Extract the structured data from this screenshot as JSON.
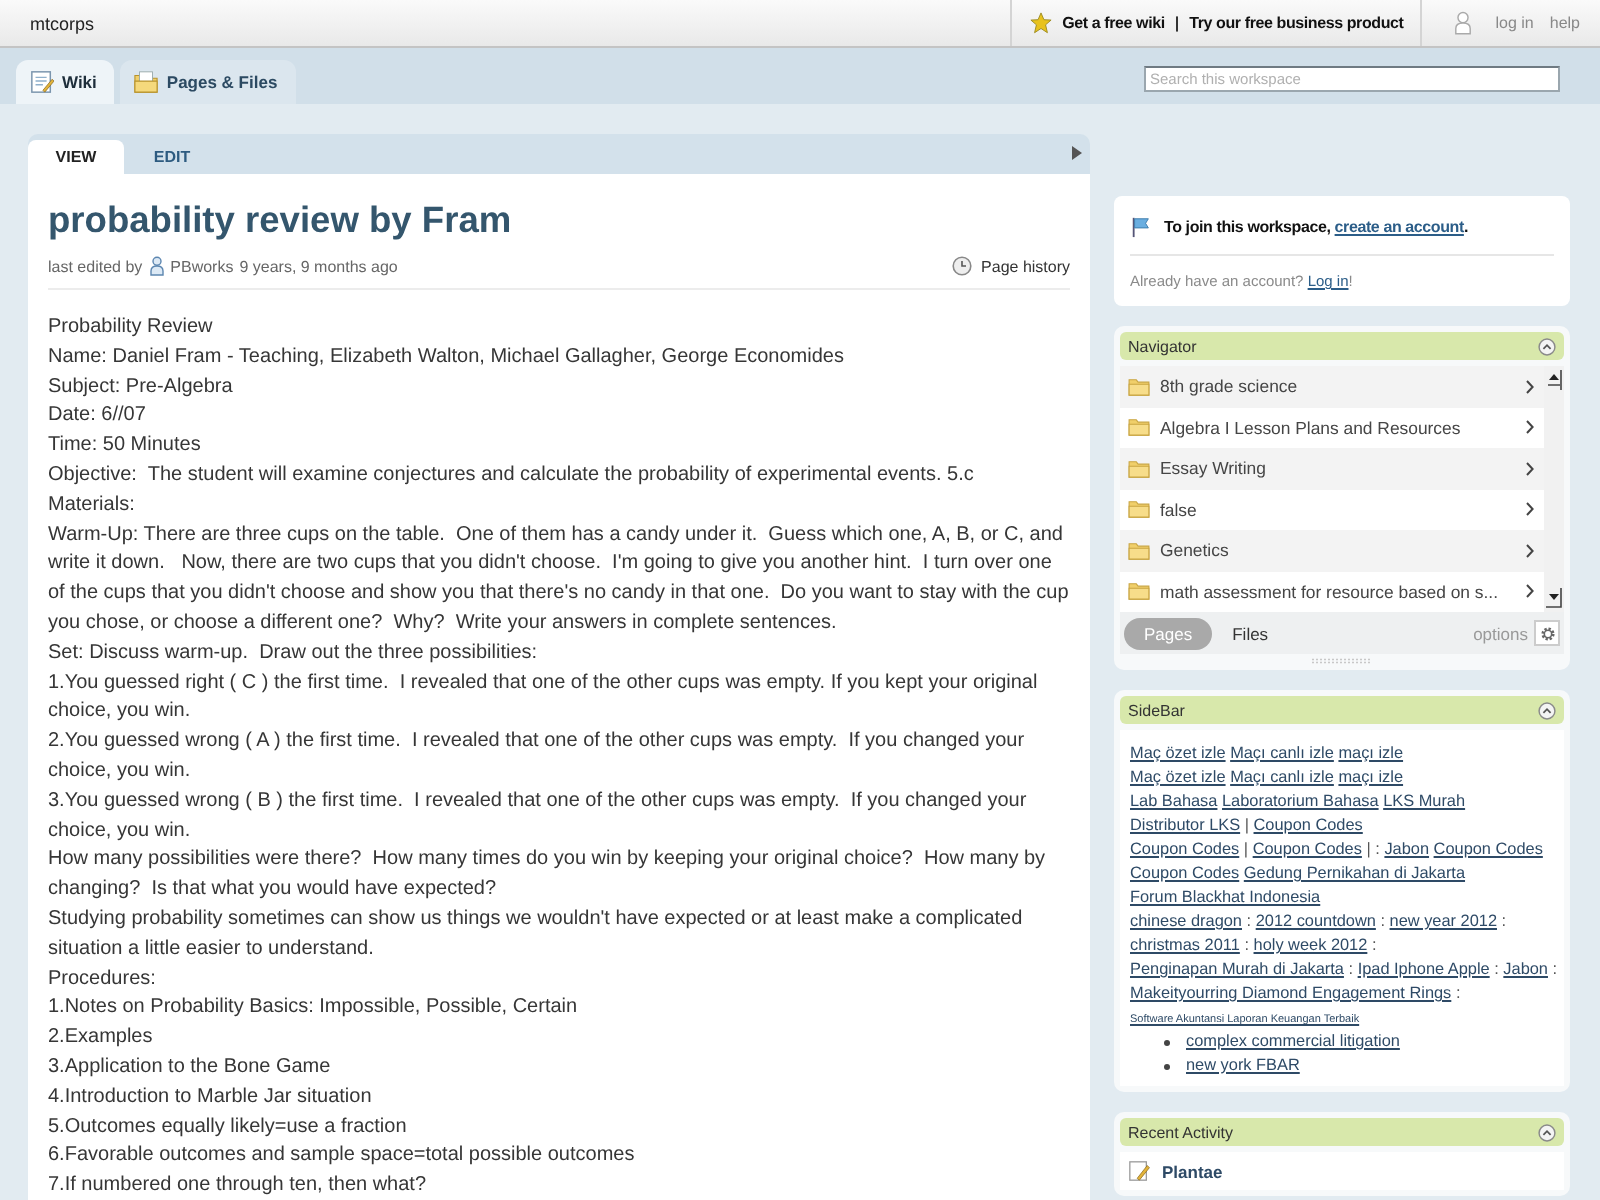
{
  "top_bar": {
    "workspace": "mtcorps",
    "promo_links": [
      "Get a free wiki",
      "Try our free business product"
    ],
    "promo_separator": "|",
    "account_links": [
      "log in",
      "help"
    ]
  },
  "workspace_tabs": [
    {
      "kind": "wiki",
      "label": "Wiki",
      "selected": true
    },
    {
      "kind": "pages",
      "label": "Pages & Files",
      "selected": false
    }
  ],
  "search": {
    "placeholder": "Search this workspace"
  },
  "page_tabs": [
    {
      "label": "VIEW",
      "selected": true
    },
    {
      "label": "EDIT",
      "selected": false
    }
  ],
  "page": {
    "title": "probability review by Fram",
    "edited_prefix": "last edited by",
    "editor": "PBworks",
    "edited_ago": "9 years, 9 months ago",
    "history_link": "Page history",
    "body": [
      "Probability Review",
      "Name: Daniel Fram - Teaching, Elizabeth Walton, Michael Gallagher, George Economides",
      "Subject: Pre-Algebra",
      "Date: 6//07",
      "Time: 50 Minutes",
      "Objective:  The student will examine conjectures and calculate the probability of experimental events. 5.c",
      "Materials:",
      "Warm-Up: There are three cups on the table.  One of them has a candy under it.  Guess which one, A, B, or C, and write it down.   Now, there are two cups that you didn't choose.  I'm going to give you another hint.  I turn over one of the cups that you didn't choose and show you that there's no candy in that one.  Do you want to stay with the cup you chose, or choose a different one?  Why?  Write your answers in complete sentences.",
      "Set: Discuss warm-up.  Draw out the three possibilities:",
      "1.You guessed right ( C ) the first time.  I revealed that one of the other cups was empty. If you kept your original choice, you win.",
      "2.You guessed wrong ( A ) the first time.  I revealed that one of the other cups was empty.  If you changed your choice, you win.",
      "3.You guessed wrong ( B ) the first time.  I revealed that one of the other cups was empty.  If you changed your choice, you win.",
      "How many possibilities were there?  How many times do you win by keeping your original choice?  How many by changing?  Is that what you would have expected?",
      "Studying probability sometimes can show us things we wouldn't have expected or at least make a complicated situation a little easier to understand.",
      "Procedures:",
      "1.Notes on Probability Basics: Impossible, Possible, Certain",
      "2.Examples",
      "3.Application to the Bone Game",
      "4.Introduction to Marble Jar situation",
      "5.Outcomes equally likely=use a fraction",
      "6.Favorable outcomes and sample space=total possible outcomes",
      "7.If numbered one through ten, then what?"
    ]
  },
  "join_box": {
    "prompt": "To join this workspace,",
    "signup_link": "create an account",
    "prompt_end": ".",
    "login_prompt": "Already have an account?",
    "login_link": "Log in",
    "login_end": "!"
  },
  "navigator": {
    "title": "Navigator",
    "expanded": true,
    "items": [
      "8th grade science",
      "Algebra I Lesson Plans and Resources",
      "Essay Writing",
      "false",
      "Genetics",
      "math assessment for resource based on s..."
    ],
    "view_tabs": [
      {
        "label": "Pages",
        "selected": true
      },
      {
        "label": "Files",
        "selected": false
      }
    ],
    "options_label": "options"
  },
  "sidebar": {
    "title": "SideBar",
    "expanded": true,
    "paragraphs": [
      [
        {
          "kind": "link",
          "text": "Maç özet izle"
        },
        {
          "kind": "link",
          "text": "Maçı canlı izle"
        },
        {
          "kind": "link",
          "text": "maçı izle"
        }
      ],
      [
        {
          "kind": "link",
          "text": "Maç özet izle"
        },
        {
          "kind": "link",
          "text": "Maçı canlı izle"
        },
        {
          "kind": "link",
          "text": "maçı izle"
        }
      ],
      [
        {
          "kind": "link",
          "text": "Lab Bahasa"
        },
        {
          "kind": "link",
          "text": "Laboratorium Bahasa"
        },
        {
          "kind": "link",
          "text": "LKS Murah"
        },
        {
          "kind": "link",
          "text": "Distributor LKS"
        },
        {
          "kind": "text",
          "text": "|"
        },
        {
          "kind": "link",
          "text": "Coupon Codes"
        }
      ],
      [
        {
          "kind": "link",
          "text": "Coupon Codes"
        },
        {
          "kind": "text",
          "text": "|"
        },
        {
          "kind": "link",
          "text": "Coupon Codes"
        },
        {
          "kind": "text",
          "text": "| :"
        },
        {
          "kind": "link",
          "text": "Jabon"
        },
        {
          "kind": "link",
          "text": "Coupon Codes"
        }
      ],
      [
        {
          "kind": "link",
          "text": "Coupon Codes"
        },
        {
          "kind": "link",
          "text": "Gedung Pernikahan di Jakarta"
        },
        {
          "kind": "link",
          "text": "Forum Blackhat Indonesia"
        }
      ],
      [
        {
          "kind": "link",
          "text": "chinese dragon"
        },
        {
          "kind": "text",
          "text": ":"
        },
        {
          "kind": "link",
          "text": "2012 countdown"
        },
        {
          "kind": "text",
          "text": ":"
        },
        {
          "kind": "link",
          "text": "new year 2012"
        },
        {
          "kind": "text",
          "text": ":"
        },
        {
          "kind": "link",
          "text": "christmas 2011"
        },
        {
          "kind": "text",
          "text": ":"
        },
        {
          "kind": "link",
          "text": "holy week 2012"
        },
        {
          "kind": "text",
          "text": ":"
        },
        {
          "kind": "link",
          "text": "Penginapan Murah di Jakarta"
        },
        {
          "kind": "text",
          "text": ":"
        },
        {
          "kind": "link",
          "text": "Ipad Iphone Apple"
        },
        {
          "kind": "text",
          "text": ":"
        },
        {
          "kind": "link",
          "text": "Jabon"
        },
        {
          "kind": "text",
          "text": ":"
        },
        {
          "kind": "link",
          "text": "Makeityourring Diamond Engagement Rings"
        },
        {
          "kind": "text",
          "text": ":"
        },
        {
          "kind": "small_link",
          "text": "Software Akuntansi Laporan Keuangan Terbaik"
        }
      ]
    ],
    "bullets": [
      "complex commercial litigation",
      "new york FBAR"
    ]
  },
  "recent_activity": {
    "title": "Recent Activity",
    "expanded": true,
    "items": [
      "Plantae"
    ]
  }
}
